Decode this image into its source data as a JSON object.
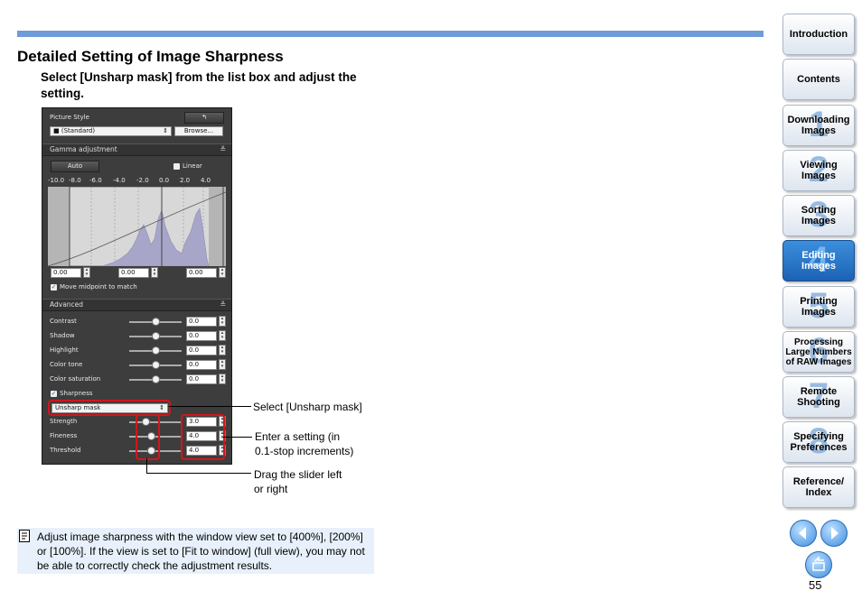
{
  "page": {
    "title": "Detailed Setting of Image Sharpness",
    "instruction": "Select [Unsharp mask] from the list box and adjust the setting.",
    "page_number": "55"
  },
  "panel": {
    "header_label": "Picture Style",
    "style_value": "(Standard)",
    "browse_label": "Browse...",
    "gamma_section": "Gamma adjustment",
    "auto_label": "Auto",
    "linear_label": "Linear",
    "scale_labels": [
      "-10.0",
      "-8.0",
      "-6.0",
      "-4.0",
      "-2.0",
      "0.0",
      "2.0",
      "4.0"
    ],
    "gamma_values": [
      "0.00",
      "0.00",
      "0.00"
    ],
    "move_midpoint": "Move midpoint to match",
    "advanced_section": "Advanced",
    "advanced_rows": [
      {
        "label": "Contrast",
        "value": "0.0"
      },
      {
        "label": "Shadow",
        "value": "0.0"
      },
      {
        "label": "Highlight",
        "value": "0.0"
      },
      {
        "label": "Color tone",
        "value": "0.0"
      },
      {
        "label": "Color saturation",
        "value": "0.0"
      }
    ],
    "sharpness_label": "Sharpness",
    "sharpness_mode": "Unsharp mask",
    "sharpness_rows": [
      {
        "label": "Strength",
        "value": "3.0"
      },
      {
        "label": "Fineness",
        "value": "4.0"
      },
      {
        "label": "Threshold",
        "value": "4.0"
      }
    ]
  },
  "callouts": {
    "select": "Select [Unsharp mask]",
    "enter_line1": "Enter a setting (in",
    "enter_line2": "0.1-stop increments)",
    "drag_line1": "Drag the slider left",
    "drag_line2": "or right"
  },
  "note": {
    "icon": "memo-icon",
    "text": "Adjust image sharpness with the window view set to [400%], [200%] or [100%]. If the view is set to [Fit to window] (full view), you may not be able to correctly check the adjustment results."
  },
  "nav": [
    {
      "label": "Introduction",
      "num": ""
    },
    {
      "label": "Contents",
      "num": ""
    },
    {
      "label": "Downloading Images",
      "num": "1"
    },
    {
      "label": "Viewing Images",
      "num": "2"
    },
    {
      "label": "Sorting Images",
      "num": "3"
    },
    {
      "label": "Editing Images",
      "num": "4",
      "active": true
    },
    {
      "label": "Printing Images",
      "num": "5"
    },
    {
      "label": "Processing Large Numbers of RAW Images",
      "num": "6"
    },
    {
      "label": "Remote Shooting",
      "num": "7"
    },
    {
      "label": "Specifying Preferences",
      "num": "8"
    },
    {
      "label": "Reference/ Index",
      "num": ""
    }
  ],
  "colors": {
    "accent": "#6f9bd8",
    "highlight_red": "#d4151b",
    "note_bg": "#e8f1fb",
    "active_nav": "#1c62b4"
  }
}
